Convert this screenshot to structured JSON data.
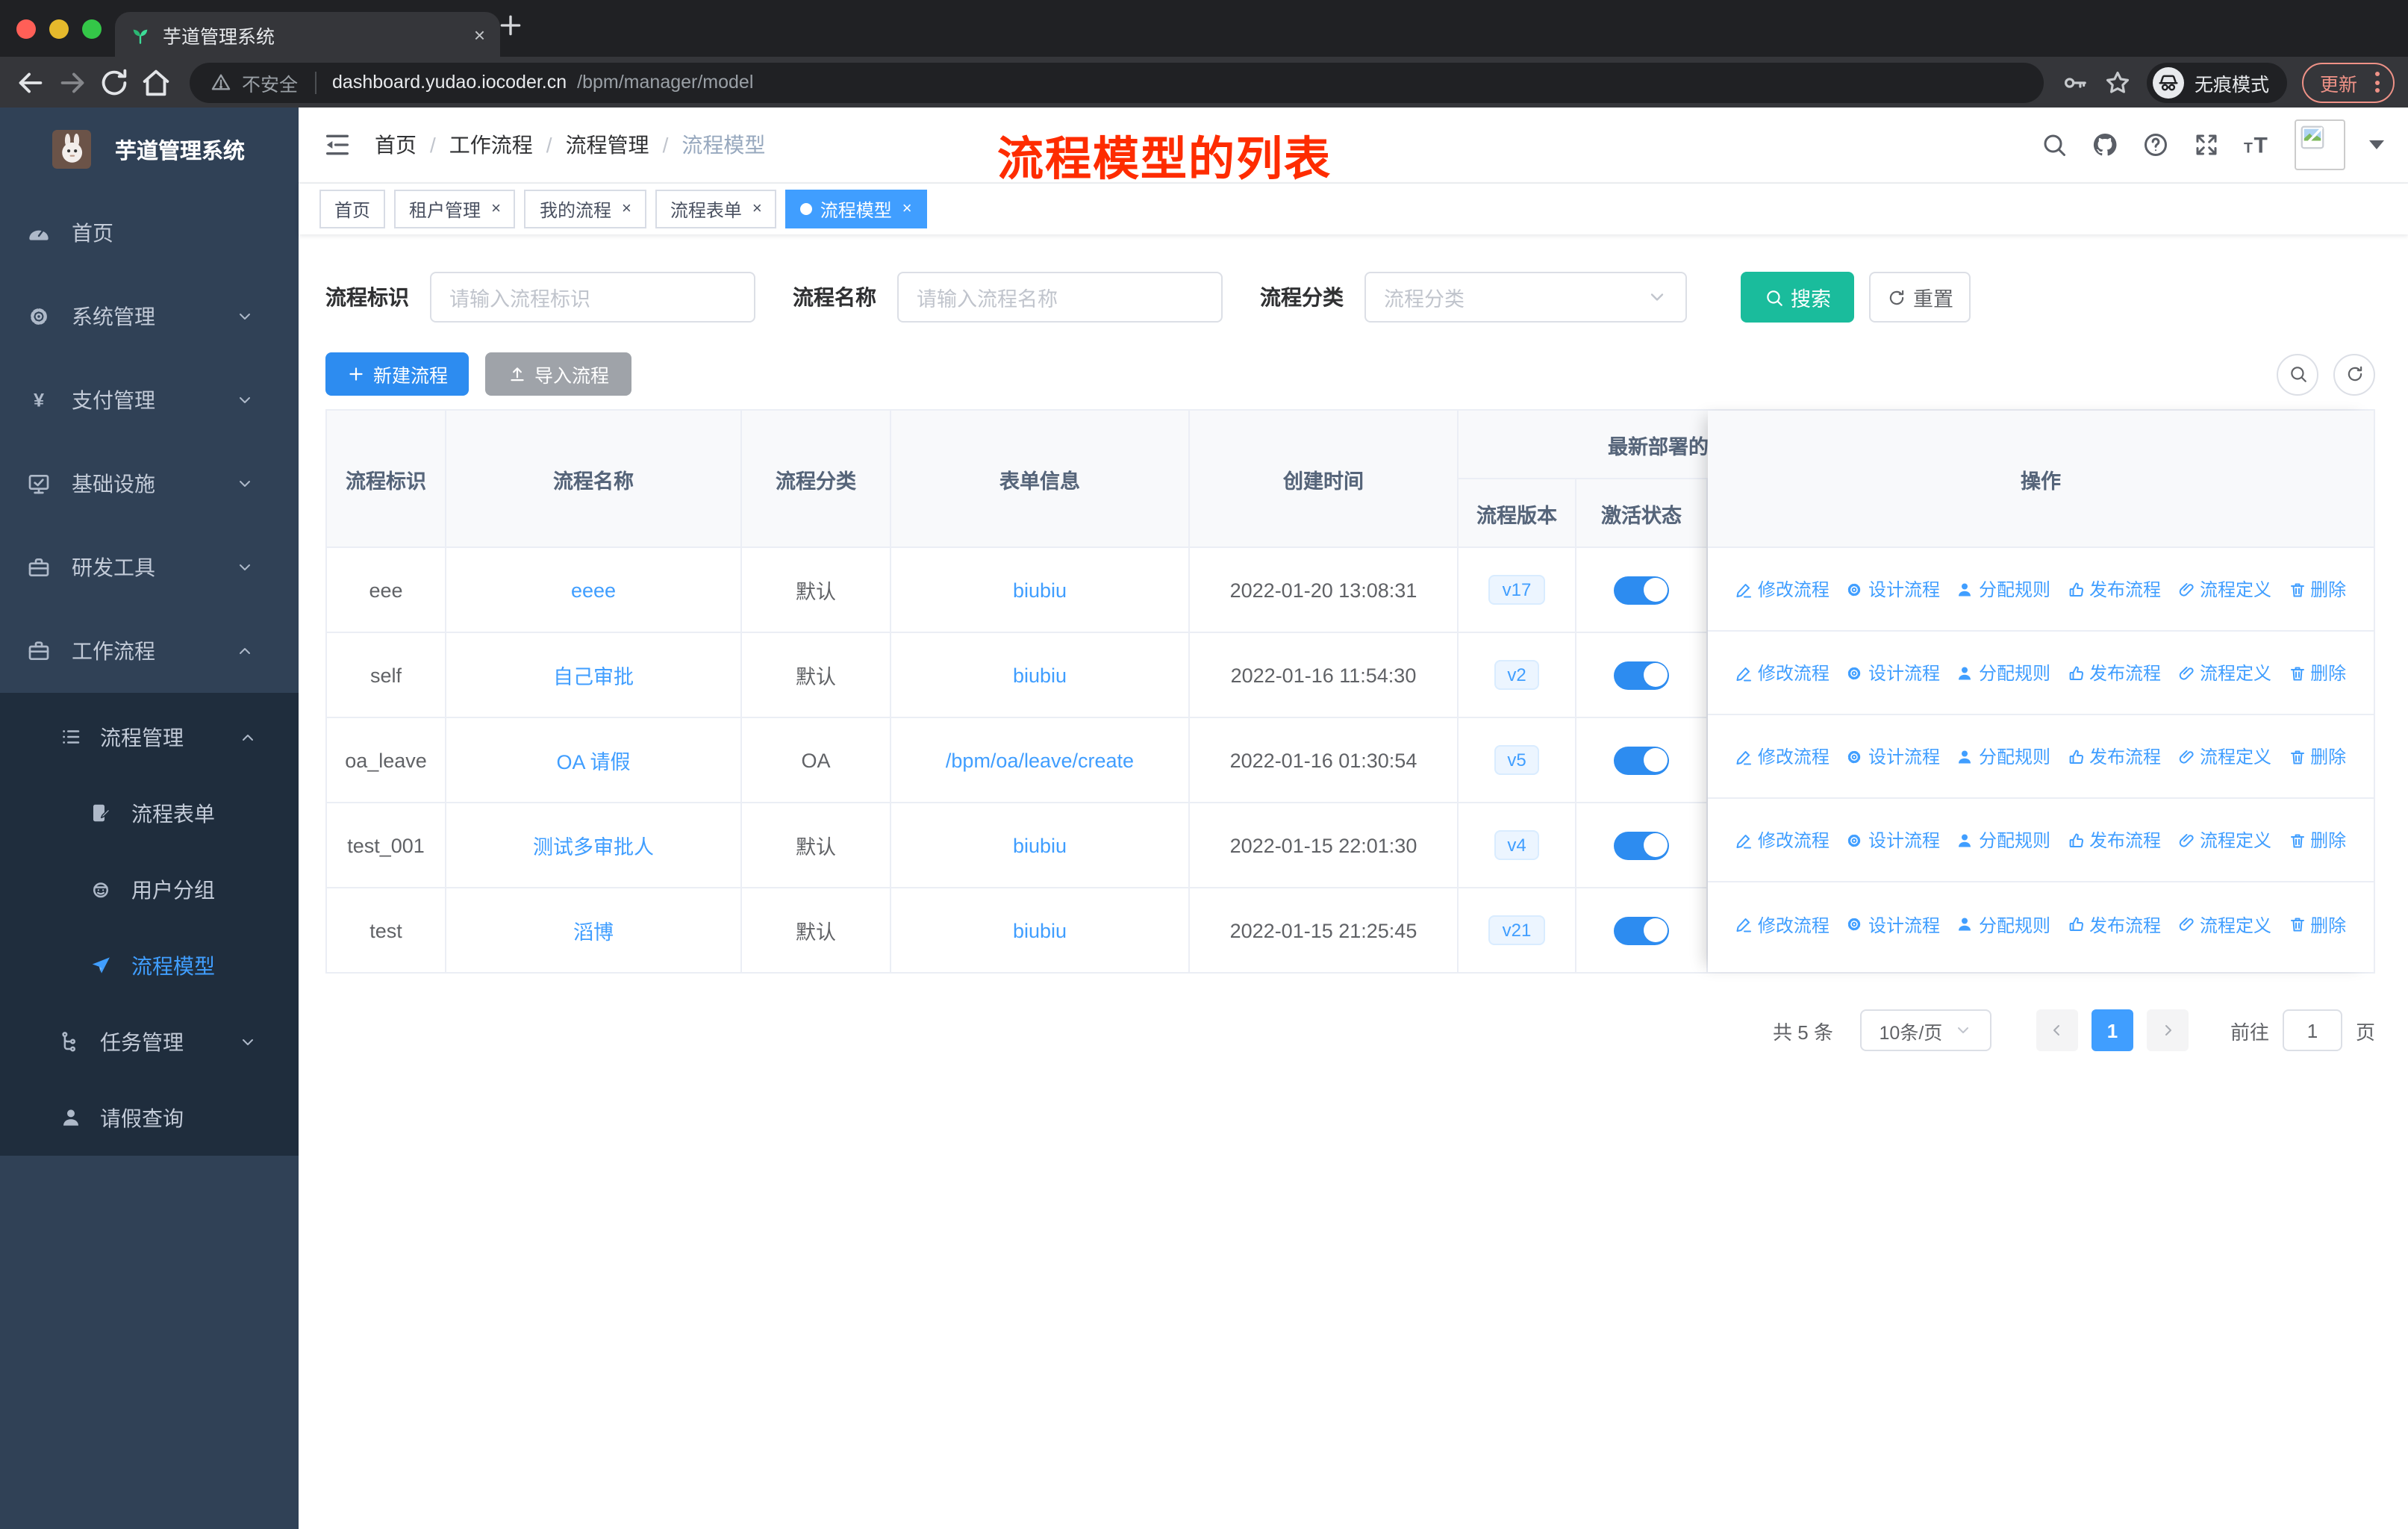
{
  "glyphs": {
    "close": "×",
    "tag_close": "×"
  },
  "colors": {
    "primary": "#409eff",
    "search_teal": "#1abc9c",
    "sidebar_bg": "#304156",
    "submenu_bg": "#1f2d3d",
    "annotation_red": "#fe2c00",
    "update_coral": "#ef9287"
  },
  "browser": {
    "tab_title": "芋道管理系统",
    "security_label": "不安全",
    "url_host": "dashboard.yudao.iocoder.cn",
    "url_path": "/bpm/manager/model",
    "incognito_label": "无痕模式",
    "update_label": "更新"
  },
  "sidebar": {
    "app_title": "芋道管理系统",
    "items": [
      {
        "key": "home",
        "label": "首页",
        "icon": "dashboard-icon",
        "expandable": false
      },
      {
        "key": "system",
        "label": "系统管理",
        "icon": "gear-icon",
        "expandable": true,
        "state": "collapsed"
      },
      {
        "key": "payment",
        "label": "支付管理",
        "icon": "yen-icon",
        "expandable": true,
        "state": "collapsed"
      },
      {
        "key": "infrastructure",
        "label": "基础设施",
        "icon": "monitor-icon",
        "expandable": true,
        "state": "collapsed"
      },
      {
        "key": "devtools",
        "label": "研发工具",
        "icon": "toolbox-icon",
        "expandable": true,
        "state": "collapsed"
      },
      {
        "key": "workflow",
        "label": "工作流程",
        "icon": "briefcase-icon",
        "expandable": true,
        "state": "expanded"
      }
    ],
    "submenu": {
      "groups": [
        {
          "key": "process-mgmt",
          "label": "流程管理",
          "icon": "list-icon",
          "state": "expanded",
          "children": [
            {
              "key": "process-form",
              "label": "流程表单",
              "icon": "form-icon",
              "active": false
            },
            {
              "key": "user-group",
              "label": "用户分组",
              "icon": "robot-icon",
              "active": false
            },
            {
              "key": "process-model",
              "label": "流程模型",
              "icon": "paper-plane-icon",
              "active": true
            }
          ]
        },
        {
          "key": "task-mgmt",
          "label": "任务管理",
          "icon": "flow-icon",
          "state": "collapsed",
          "children": []
        },
        {
          "key": "leave-query",
          "label": "请假查询",
          "icon": "user-icon",
          "state": "none",
          "children": []
        }
      ]
    }
  },
  "navbar": {
    "breadcrumb": [
      "首页",
      "工作流程",
      "流程管理",
      "流程模型"
    ],
    "annotation": "流程模型的列表"
  },
  "tags": [
    {
      "key": "home",
      "label": "首页",
      "closable": false,
      "active": false
    },
    {
      "key": "tenant-mgmt",
      "label": "租户管理",
      "closable": true,
      "active": false
    },
    {
      "key": "my-process",
      "label": "我的流程",
      "closable": true,
      "active": false
    },
    {
      "key": "process-form",
      "label": "流程表单",
      "closable": true,
      "active": false
    },
    {
      "key": "process-model",
      "label": "流程模型",
      "closable": true,
      "active": true
    }
  ],
  "filters": {
    "fields": [
      {
        "label": "流程标识",
        "type": "input",
        "placeholder": "请输入流程标识"
      },
      {
        "label": "流程名称",
        "type": "input",
        "placeholder": "请输入流程名称"
      },
      {
        "label": "流程分类",
        "type": "select",
        "placeholder": "流程分类"
      }
    ],
    "search_label": "搜索",
    "reset_label": "重置"
  },
  "toolbar": {
    "create_label": "新建流程",
    "import_label": "导入流程"
  },
  "table": {
    "columns": [
      "流程标识",
      "流程名称",
      "流程分类",
      "表单信息",
      "创建时间"
    ],
    "group_header": "最新部署的",
    "sub_columns": [
      "流程版本",
      "激活状态"
    ],
    "actions_header": "操作",
    "actions": [
      {
        "key": "modify",
        "label": "修改流程",
        "icon": "pencil-icon"
      },
      {
        "key": "design",
        "label": "设计流程",
        "icon": "gear-icon"
      },
      {
        "key": "assign-rule",
        "label": "分配规则",
        "icon": "assign-user-icon"
      },
      {
        "key": "publish",
        "label": "发布流程",
        "icon": "publish-icon"
      },
      {
        "key": "definition",
        "label": "流程定义",
        "icon": "paperclip-icon"
      },
      {
        "key": "delete",
        "label": "删除",
        "icon": "trash-icon"
      }
    ],
    "rows": [
      {
        "id": "eee",
        "name": "eeee",
        "category": "默认",
        "form": "biubiu",
        "created": "2022-01-20 13:08:31",
        "version": "v17",
        "active": true
      },
      {
        "id": "self",
        "name": "自己审批",
        "category": "默认",
        "form": "biubiu",
        "created": "2022-01-16 11:54:30",
        "version": "v2",
        "active": true
      },
      {
        "id": "oa_leave",
        "name": "OA 请假",
        "category": "OA",
        "form": "/bpm/oa/leave/create",
        "created": "2022-01-16 01:30:54",
        "version": "v5",
        "active": true
      },
      {
        "id": "test_001",
        "name": "测试多审批人",
        "category": "默认",
        "form": "biubiu",
        "created": "2022-01-15 22:01:30",
        "version": "v4",
        "active": true
      },
      {
        "id": "test",
        "name": "滔博",
        "category": "默认",
        "form": "biubiu",
        "created": "2022-01-15 21:25:45",
        "version": "v21",
        "active": true
      }
    ]
  },
  "pagination": {
    "total_label": "共 5 条",
    "page_size": "10条/页",
    "current_page": "1",
    "goto_label": "前往",
    "goto_value": "1",
    "page_label": "页"
  }
}
